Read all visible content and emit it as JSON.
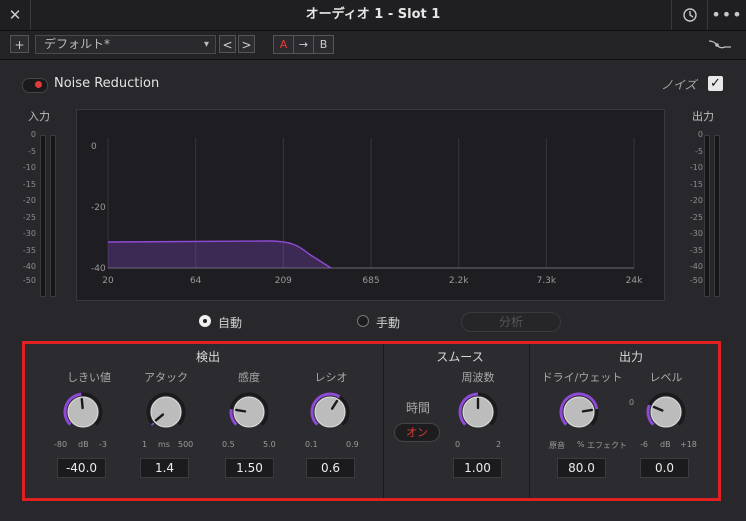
{
  "window": {
    "title": "オーディオ 1 - Slot 1"
  },
  "toolbar": {
    "add_label": "+",
    "preset": "デフォルト*",
    "prev_label": "<",
    "next_label": ">",
    "a_label": "A",
    "copy_label": "→",
    "b_label": "B"
  },
  "header": {
    "enable_label": "Noise Reduction",
    "noise_label": "ノイズ",
    "noise_checked": true,
    "accent": "#e03a36"
  },
  "input_meter": {
    "label": "入力",
    "ticks": [
      "0",
      "-5",
      "-10",
      "-15",
      "-20",
      "-25",
      "-30",
      "-35",
      "-40",
      "-50"
    ]
  },
  "output_meter": {
    "label": "出力",
    "ticks": [
      "0",
      "-5",
      "-10",
      "-15",
      "-20",
      "-25",
      "-30",
      "-35",
      "-40",
      "-50"
    ]
  },
  "graph": {
    "y_ticks": [
      "0",
      "-20",
      "-40"
    ],
    "x_ticks": [
      "20",
      "64",
      "209",
      "685",
      "2.2k",
      "7.3k",
      "24k"
    ],
    "curve_color": "#8e4ad6"
  },
  "mode": {
    "auto_label": "自動",
    "manual_label": "手動",
    "analyze_label": "分析",
    "selected": "auto"
  },
  "panel": {
    "border_color": "#e02121",
    "detect": {
      "title": "検出",
      "threshold": {
        "label": "しきい値",
        "min": "-80",
        "unit": "dB",
        "max": "-3",
        "value": "-40.0",
        "level": 0.48
      },
      "attack": {
        "label": "アタック",
        "min": "1",
        "unit": "ms",
        "max": "500",
        "value": "1.4",
        "level": 0.02
      },
      "sensitivity": {
        "label": "感度",
        "min": "0.5",
        "max": "5.0",
        "value": "1.50",
        "level": 0.2
      },
      "ratio": {
        "label": "レシオ",
        "min": "0.1",
        "max": "0.9",
        "value": "0.6",
        "level": 0.62
      }
    },
    "smooth": {
      "title": "スムース",
      "time_label": "時間",
      "on_label": "オン",
      "frequency": {
        "label": "周波数",
        "min": "0",
        "max": "2",
        "value": "1.00",
        "level": 0.5
      }
    },
    "output": {
      "title": "出力",
      "drywet": {
        "label": "ドライ/ウェット",
        "min": "原音",
        "unit": "%",
        "max": "エフェクト",
        "value": "80.0",
        "level": 0.8
      },
      "level": {
        "label": "レベル",
        "min": "-6",
        "unit": "dB",
        "max": "+18",
        "top": "0",
        "value": "0.0",
        "level": 0.25
      }
    }
  }
}
